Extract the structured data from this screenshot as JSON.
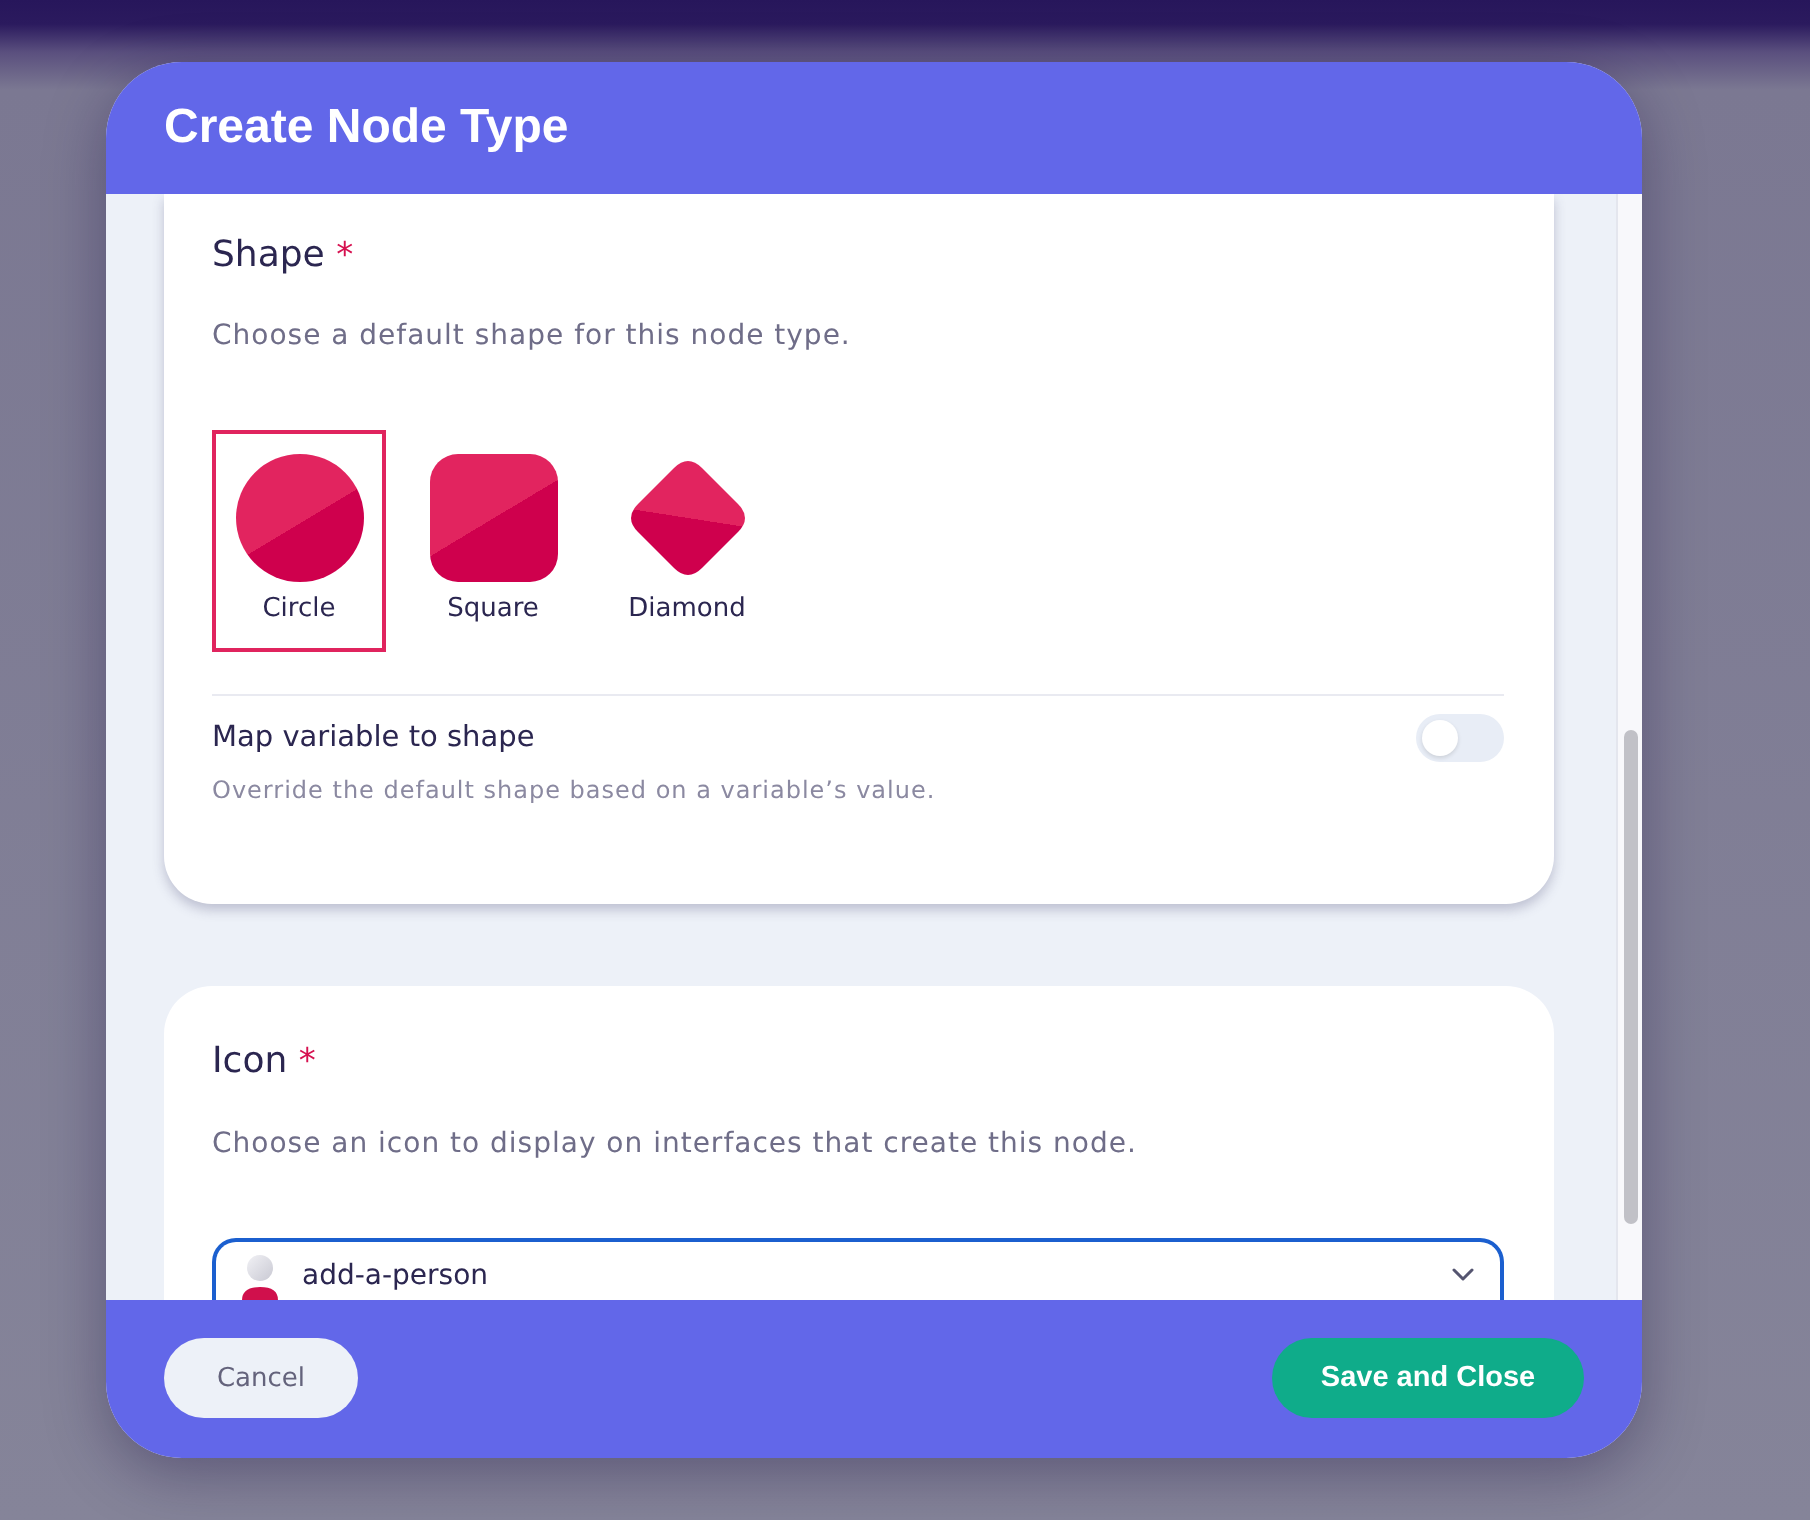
{
  "dialog": {
    "title": "Create Node Type"
  },
  "sections": [
    {
      "kind": "shape",
      "title": "Shape",
      "required_mark": "*",
      "description": "Choose a default shape for this node type.",
      "options": [
        {
          "kind": "circle",
          "label": "Circle",
          "selected": true
        },
        {
          "kind": "square",
          "label": "Square",
          "selected": false
        },
        {
          "kind": "diamond",
          "label": "Diamond",
          "selected": false
        }
      ],
      "setting": {
        "label": "Map variable to shape",
        "description": "Override the default shape based on a variable’s value.",
        "on": false
      }
    },
    {
      "kind": "icon",
      "title": "Icon",
      "required_mark": "*",
      "description": "Choose an icon to display on interfaces that create this node.",
      "select": {
        "value": "add-a-person"
      }
    }
  ],
  "buttons": [
    {
      "kind": "secondary",
      "label": "Cancel"
    },
    {
      "kind": "primary",
      "label": "Save and Close"
    }
  ]
}
